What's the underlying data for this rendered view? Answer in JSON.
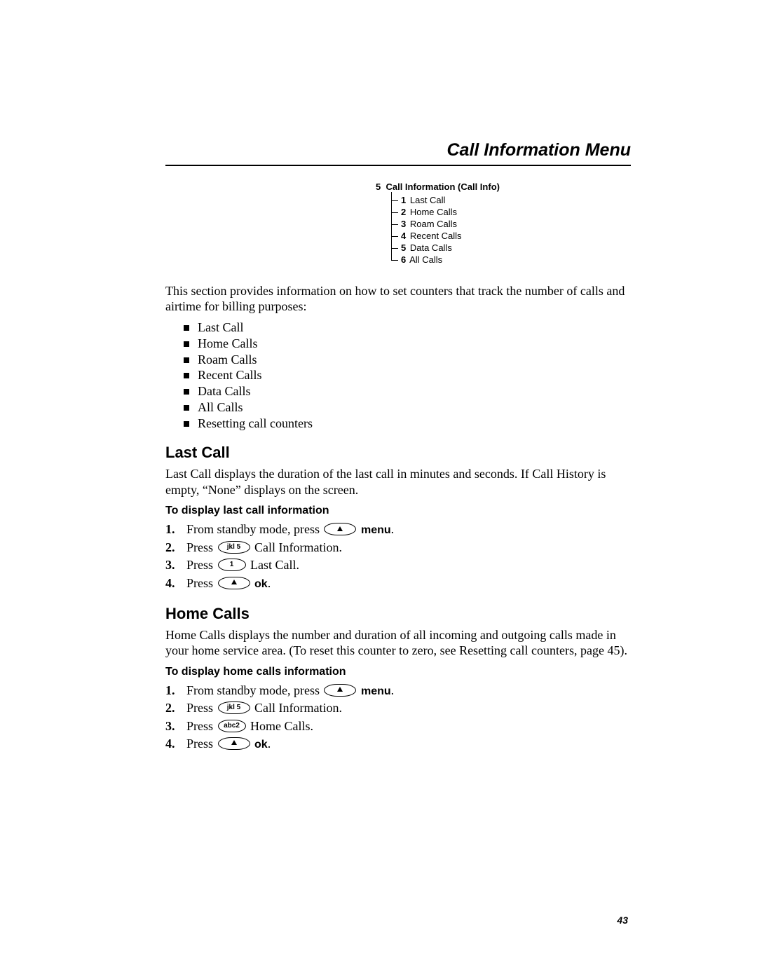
{
  "page_number": "43",
  "title": "Call Information Menu",
  "menu_tree": {
    "header_num": "5",
    "header_label": "Call Information (Call Info)",
    "items": [
      {
        "num": "1",
        "label": "Last Call"
      },
      {
        "num": "2",
        "label": "Home Calls"
      },
      {
        "num": "3",
        "label": "Roam Calls"
      },
      {
        "num": "4",
        "label": "Recent Calls"
      },
      {
        "num": "5",
        "label": "Data Calls"
      },
      {
        "num": "6",
        "label": "All Calls"
      }
    ]
  },
  "intro": "This section provides information on how to set counters that track the number of calls and airtime for billing purposes:",
  "bullets": [
    "Last Call",
    "Home Calls",
    "Roam Calls",
    "Recent Calls",
    "Data Calls",
    "All Calls",
    "Resetting call counters"
  ],
  "last_call": {
    "heading": "Last Call",
    "para": "Last Call displays the duration of the last call in minutes and seconds. If Call History is empty, “None” displays on the screen.",
    "sub_head": "To display last call information",
    "steps": [
      {
        "num": "1.",
        "pre": "From standby mode, press ",
        "key": "nav-up",
        "post_bold": "menu",
        "post": "."
      },
      {
        "num": "2.",
        "pre": "Press ",
        "key": "jkl5",
        "post": " Call Information."
      },
      {
        "num": "3.",
        "pre": "Press ",
        "key": "one",
        "post": " Last Call."
      },
      {
        "num": "4.",
        "pre": "Press ",
        "key": "nav-up",
        "post_bold": "ok",
        "post": "."
      }
    ]
  },
  "home_calls": {
    "heading": "Home Calls",
    "para": "Home Calls displays the number and duration of all incoming and outgoing calls made in your home service area. (To reset this counter to zero, see Resetting call counters, page 45).",
    "sub_head": "To display home calls information",
    "steps": [
      {
        "num": "1.",
        "pre": "From standby mode, press ",
        "key": "nav-up",
        "post_bold": "menu",
        "post": "."
      },
      {
        "num": "2.",
        "pre": "Press ",
        "key": "jkl5",
        "post": " Call Information."
      },
      {
        "num": "3.",
        "pre": "Press ",
        "key": "abc2",
        "post": " Home Calls."
      },
      {
        "num": "4.",
        "pre": "Press ",
        "key": "nav-up",
        "post_bold": "ok",
        "post": "."
      }
    ]
  },
  "keys": {
    "nav-up": "",
    "jkl5": "jkl 5",
    "one": "1",
    "abc2": "abc2"
  }
}
